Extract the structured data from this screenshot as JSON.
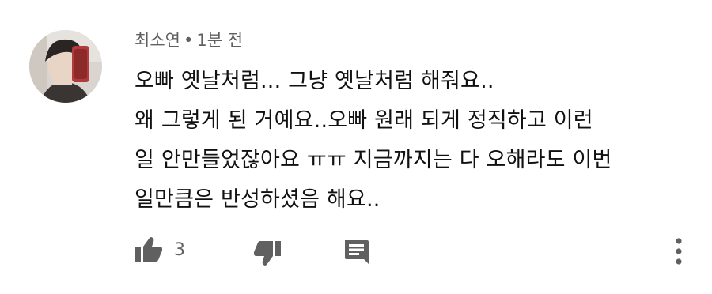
{
  "comment": {
    "author": "최소연",
    "separator": "•",
    "time": "1분 전",
    "text_lines": [
      "오빠 옛날처럼... 그냥 옛날처럼 해줘요..",
      "왜 그렇게 된 거예요..오빠 원래 되게 정직하고 이런",
      "일 안만들었잖아요 ㅠㅠ 지금까지는 다 오해라도 이번",
      "일만큼은 반성하셨음 해요.."
    ],
    "like_count": "3"
  },
  "icons": {
    "like": "thumbs-up-icon",
    "dislike": "thumbs-down-icon",
    "reply": "reply-comment-icon",
    "more": "more-vertical-icon"
  },
  "colors": {
    "icon": "#606060",
    "meta_text": "#606060",
    "body_text": "#111111"
  }
}
